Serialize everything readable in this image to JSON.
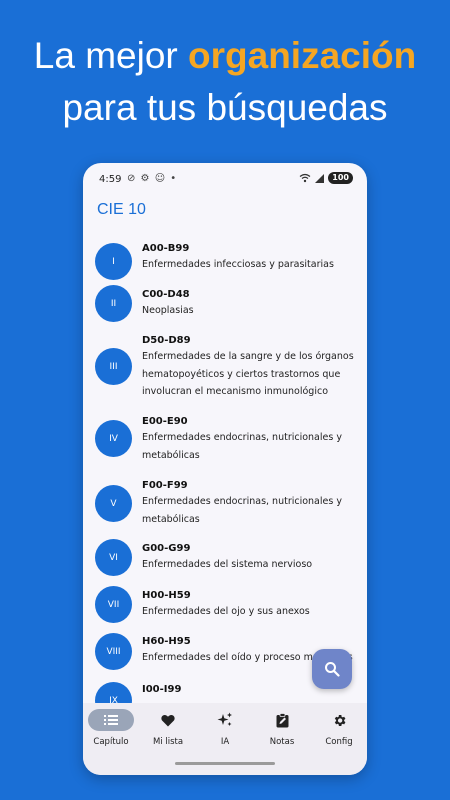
{
  "promo": {
    "line1_prefix": "La mejor ",
    "line1_highlight": "organización",
    "line2": "para tus búsquedas",
    "highlight_color": "#f5a623",
    "background_color": "#1a6fd6"
  },
  "status_bar": {
    "time": "4:59",
    "icons": "⊘ ⚙ ☺ •",
    "battery": "100"
  },
  "app": {
    "title": "CIE 10",
    "accent_color": "#1a6fd6"
  },
  "chapters": [
    {
      "roman": "I",
      "range": "A00-B99",
      "desc": [
        "Enfermedades infecciosas y parasitarias"
      ]
    },
    {
      "roman": "II",
      "range": "C00-D48",
      "desc": [
        "Neoplasias"
      ]
    },
    {
      "roman": "III",
      "range": "D50-D89",
      "desc": [
        "Enfermedades de la sangre y de los órganos",
        "hematopoyéticos y ciertos trastornos que",
        "involucran el mecanismo inmunológico"
      ]
    },
    {
      "roman": "IV",
      "range": "E00-E90",
      "desc": [
        "Enfermedades endocrinas, nutricionales y",
        "metabólicas"
      ]
    },
    {
      "roman": "V",
      "range": "F00-F99",
      "desc": [
        "Enfermedades endocrinas, nutricionales y",
        "metabólicas"
      ]
    },
    {
      "roman": "VI",
      "range": "G00-G99",
      "desc": [
        "Enfermedades del sistema nervioso"
      ]
    },
    {
      "roman": "VII",
      "range": "H00-H59",
      "desc": [
        "Enfermedades del ojo y sus anexos"
      ]
    },
    {
      "roman": "VIII",
      "range": "H60-H95",
      "desc": [
        "Enfermedades del oído y proceso mastoides"
      ]
    },
    {
      "roman": "IX",
      "range": "I00-I99",
      "desc": []
    }
  ],
  "fab": {
    "icon": "search-icon"
  },
  "nav": [
    {
      "label": "Capítulo",
      "icon": "list-icon",
      "active": true
    },
    {
      "label": "Mi lista",
      "icon": "heart-icon",
      "active": false
    },
    {
      "label": "IA",
      "icon": "sparkle-icon",
      "active": false
    },
    {
      "label": "Notas",
      "icon": "note-icon",
      "active": false
    },
    {
      "label": "Config",
      "icon": "gear-icon",
      "active": false
    }
  ]
}
